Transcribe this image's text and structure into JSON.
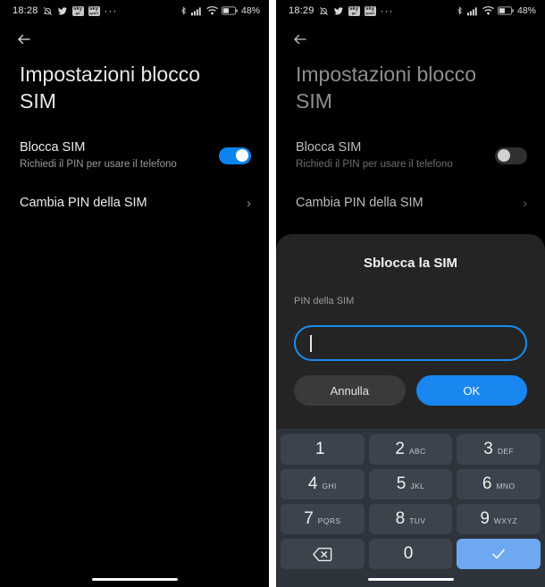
{
  "left": {
    "status_bar": {
      "time": "18:28",
      "battery_percent": "48%",
      "icons": [
        "mute-icon",
        "twitter-icon",
        "sky-go-icon",
        "sky-sport-icon",
        "more-icon",
        "bluetooth-icon",
        "signal-icon",
        "wifi-icon",
        "battery-icon"
      ],
      "sky_label_top": "sky",
      "sky_label_bottom_1": "go",
      "sky_label_bottom_2": "sport",
      "overflow": "···"
    },
    "page_title": "Impostazioni blocco SIM",
    "rows": [
      {
        "title": "Blocca SIM",
        "subtitle": "Richiedi il PIN per usare il telefono",
        "toggle": "on"
      },
      {
        "title": "Cambia PIN della SIM",
        "chevron": "›"
      }
    ]
  },
  "right": {
    "status_bar": {
      "time": "18:29",
      "battery_percent": "48%",
      "overflow": "···"
    },
    "page_title": "Impostazioni blocco SIM",
    "rows": [
      {
        "title": "Blocca SIM",
        "subtitle": "Richiedi il PIN per usare il telefono",
        "toggle": "off"
      },
      {
        "title": "Cambia PIN della SIM",
        "chevron": "›"
      }
    ],
    "dialog": {
      "title": "Sblocca la SIM",
      "field_label": "PIN della SIM",
      "input_value": "",
      "input_placeholder": "",
      "cancel_label": "Annulla",
      "ok_label": "OK"
    },
    "keypad": {
      "keys": [
        {
          "num": "1",
          "letters": ""
        },
        {
          "num": "2",
          "letters": "ABC"
        },
        {
          "num": "3",
          "letters": "DEF"
        },
        {
          "num": "4",
          "letters": "GHI"
        },
        {
          "num": "5",
          "letters": "JKL"
        },
        {
          "num": "6",
          "letters": "MNO"
        },
        {
          "num": "7",
          "letters": "PQRS"
        },
        {
          "num": "8",
          "letters": "TUV"
        },
        {
          "num": "9",
          "letters": "WXYZ"
        },
        {
          "num": "0",
          "letters": ""
        }
      ],
      "backspace_icon": "backspace-icon",
      "confirm_icon": "check-icon"
    }
  },
  "colors": {
    "accent_blue": "#0b84f3",
    "dialog_bg": "#242424",
    "keypad_bg": "#2e343c",
    "key_bg": "#3c434c",
    "confirm_key": "#6ea8f0",
    "screen_bg": "#000000"
  }
}
